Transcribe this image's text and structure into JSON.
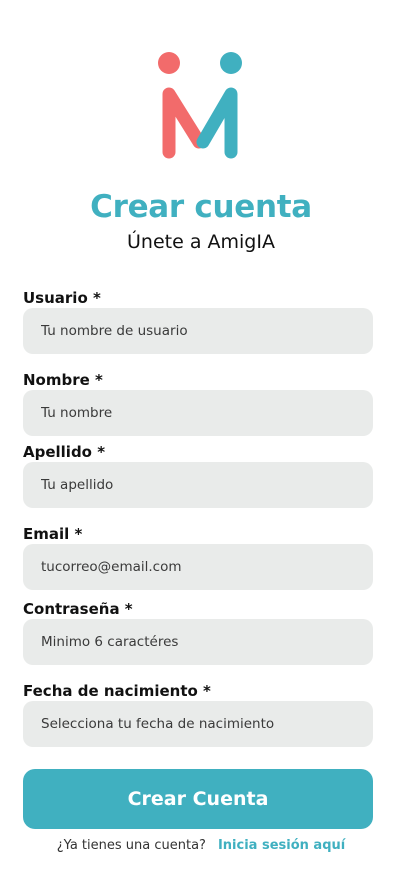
{
  "header": {
    "logo_icon": "amigia-logo-icon",
    "title": "Crear cuenta",
    "subtitle": "Únete a AmigIA"
  },
  "colors": {
    "accent": "#40b0c0",
    "logo_coral": "#f26b6b",
    "logo_teal": "#40b0c0",
    "input_background": "#e9ebea"
  },
  "form": {
    "username": {
      "label": "Usuario *",
      "placeholder": "Tu nombre de usuario"
    },
    "first_name": {
      "label": "Nombre *",
      "placeholder": "Tu nombre"
    },
    "last_name": {
      "label": "Apellido *",
      "placeholder": "Tu apellido"
    },
    "email": {
      "label": "Email *",
      "placeholder": "tucorreo@email.com"
    },
    "password": {
      "label": "Contraseña *",
      "placeholder": "Minimo 6 caractéres"
    },
    "birthdate": {
      "label": "Fecha de nacimiento *",
      "placeholder": "Selecciona tu fecha de nacimiento"
    },
    "submit_label": "Crear Cuenta"
  },
  "footer": {
    "question": "¿Ya tienes una cuenta?",
    "login_link": "Inicia sesión aquí"
  }
}
